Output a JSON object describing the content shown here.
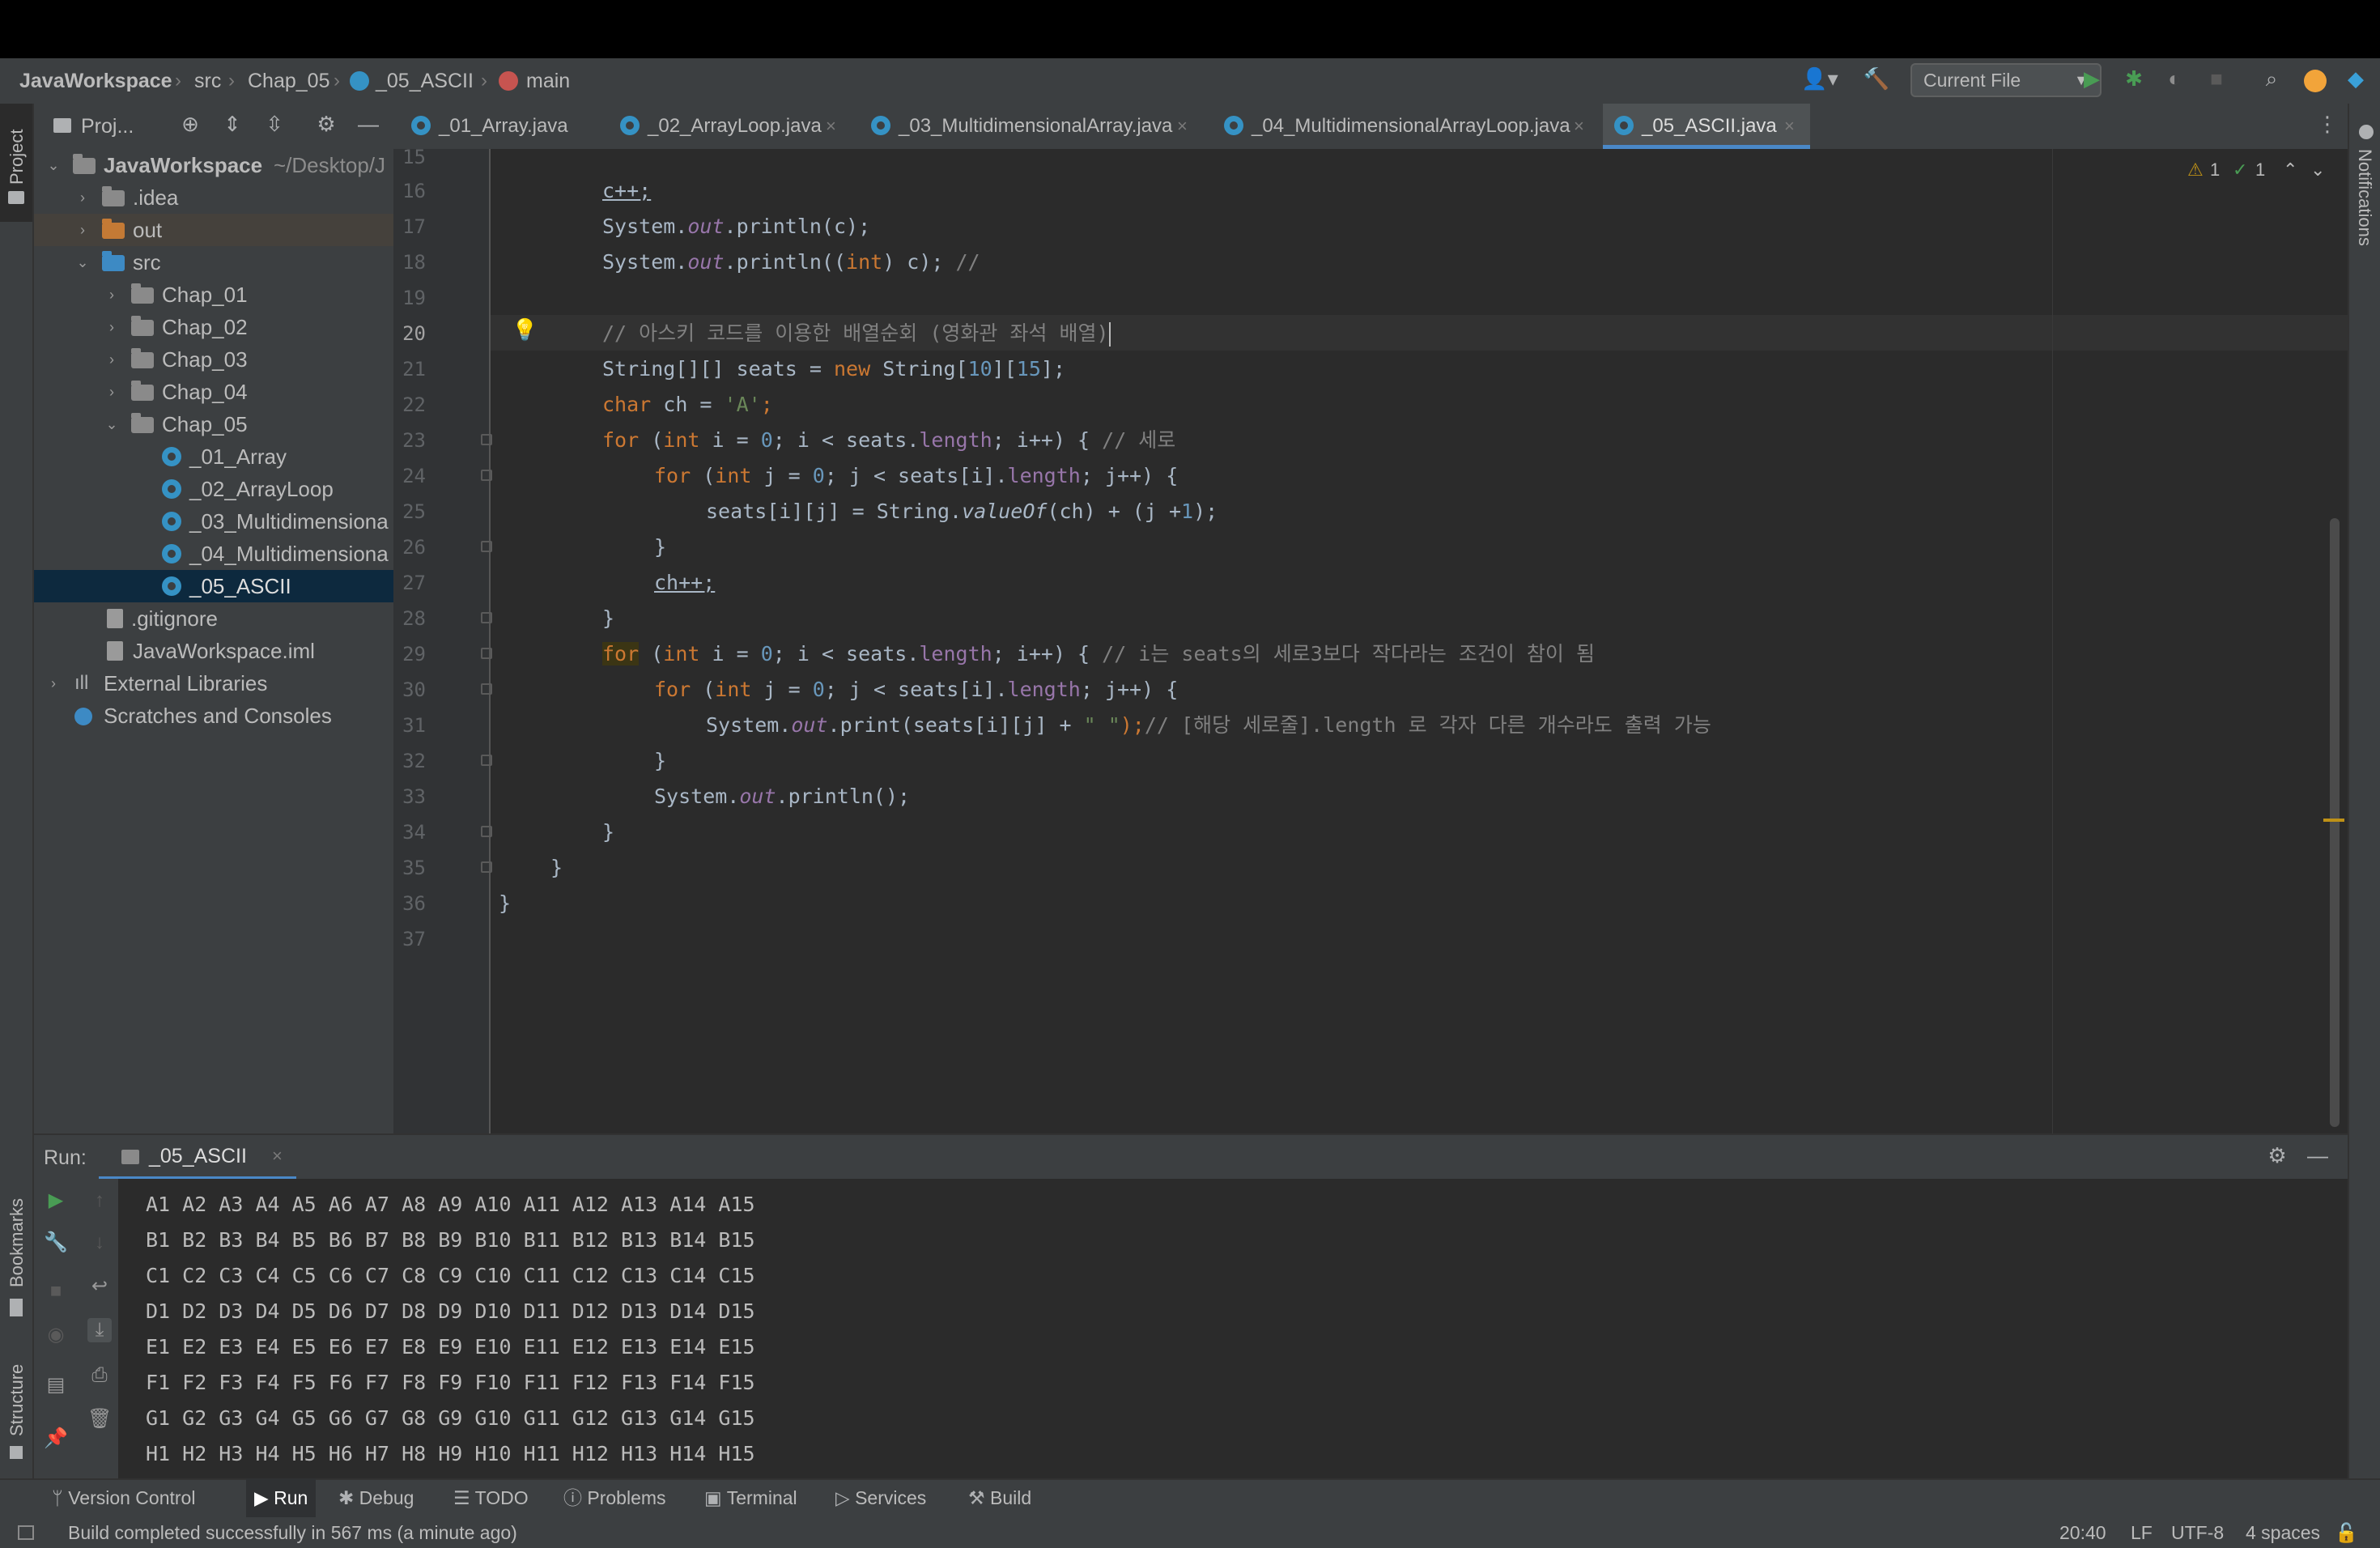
{
  "breadcrumb": {
    "project": "JavaWorkspace",
    "src": "src",
    "chapter": "Chap_05",
    "class": "_05_ASCII",
    "method": "main"
  },
  "toolbar": {
    "run_config": "Current File"
  },
  "stripes": {
    "project": "Project",
    "notifications": "Notifications",
    "bookmarks": "Bookmarks",
    "structure": "Structure"
  },
  "project_panel": {
    "title": "Proj...",
    "items": [
      {
        "label": "JavaWorkspace",
        "hint": "~/Desktop/J"
      },
      {
        "label": ".idea"
      },
      {
        "label": "out"
      },
      {
        "label": "src"
      },
      {
        "label": "Chap_01"
      },
      {
        "label": "Chap_02"
      },
      {
        "label": "Chap_03"
      },
      {
        "label": "Chap_04"
      },
      {
        "label": "Chap_05"
      },
      {
        "label": "_01_Array"
      },
      {
        "label": "_02_ArrayLoop"
      },
      {
        "label": "_03_Multidimensiona"
      },
      {
        "label": "_04_Multidimensiona"
      },
      {
        "label": "_05_ASCII"
      },
      {
        "label": ".gitignore"
      },
      {
        "label": "JavaWorkspace.iml"
      },
      {
        "label": "External Libraries"
      },
      {
        "label": "Scratches and Consoles"
      }
    ]
  },
  "tabs": [
    {
      "label": "_01_Array.java"
    },
    {
      "label": "_02_ArrayLoop.java"
    },
    {
      "label": "_03_MultidimensionalArray.java"
    },
    {
      "label": "_04_MultidimensionalArrayLoop.java"
    },
    {
      "label": "_05_ASCII.java"
    }
  ],
  "inspections": {
    "warnings": "1",
    "weak_warnings": "1"
  },
  "editor": {
    "line_numbers": [
      "15",
      "16",
      "17",
      "18",
      "19",
      "20",
      "21",
      "22",
      "23",
      "24",
      "25",
      "26",
      "27",
      "28",
      "29",
      "30",
      "31",
      "32",
      "33",
      "34",
      "35",
      "36",
      "37"
    ],
    "lines": {
      "l16": "c++;",
      "l17a": "System.",
      "l17b": "out",
      "l17c": ".println(c);",
      "l18a": "System.",
      "l18b": "out",
      "l18c": ".println((",
      "l18d": "int",
      "l18e": ") c); ",
      "l18f": "//",
      "l20": "// 아스키 코드를 이용한 배열순회 (영화관 좌석 배열)",
      "l21a": "String[][] seats = ",
      "l21b": "new",
      "l21c": " String[",
      "l21d": "10",
      "l21e": "][",
      "l21f": "15",
      "l21g": "];",
      "l22a": "char",
      "l22b": " ch = ",
      "l22c": "'A'",
      "l22d": ";",
      "l23a": "for",
      "l23b": " (",
      "l23c": "int",
      "l23d": " i = ",
      "l23e": "0",
      "l23f": "; i < seats.",
      "l23g": "length",
      "l23h": "; i++) { ",
      "l23i": "// 세로",
      "l24a": "for",
      "l24b": " (",
      "l24c": "int",
      "l24d": " j = ",
      "l24e": "0",
      "l24f": "; j < seats[i].",
      "l24g": "length",
      "l24h": "; j++) {",
      "l25a": "seats[i][j] = String.",
      "l25b": "valueOf",
      "l25c": "(ch) + (j +",
      "l25d": "1",
      "l25e": ");",
      "l26": "}",
      "l27": "ch++;",
      "l28": "}",
      "l29a": "for",
      "l29b": " (",
      "l29c": "int",
      "l29d": " i = ",
      "l29e": "0",
      "l29f": "; i < seats.",
      "l29g": "length",
      "l29h": "; i++) { ",
      "l29i": "// i는 seats의 세로3보다 작다라는 조건이 참이 됨",
      "l30a": "for",
      "l30b": " (",
      "l30c": "int",
      "l30d": " j = ",
      "l30e": "0",
      "l30f": "; j < seats[i].",
      "l30g": "length",
      "l30h": "; j++) {",
      "l31a": "System.",
      "l31b": "out",
      "l31c": ".print(seats[i][j] + ",
      "l31d": "\" \"",
      "l31e": ");",
      "l31f": "// [해당 세로줄].length 로 각자 다른 개수라도 출력 가능",
      "l32": "}",
      "l33a": "System.",
      "l33b": "out",
      "l33c": ".println();",
      "l34": "}",
      "l35": "}",
      "l36": "}"
    }
  },
  "run_panel": {
    "label": "Run:",
    "tab": "_05_ASCII",
    "output": [
      "A1 A2 A3 A4 A5 A6 A7 A8 A9 A10 A11 A12 A13 A14 A15",
      "B1 B2 B3 B4 B5 B6 B7 B8 B9 B10 B11 B12 B13 B14 B15",
      "C1 C2 C3 C4 C5 C6 C7 C8 C9 C10 C11 C12 C13 C14 C15",
      "D1 D2 D3 D4 D5 D6 D7 D8 D9 D10 D11 D12 D13 D14 D15",
      "E1 E2 E3 E4 E5 E6 E7 E8 E9 E10 E11 E12 E13 E14 E15",
      "F1 F2 F3 F4 F5 F6 F7 F8 F9 F10 F11 F12 F13 F14 F15",
      "G1 G2 G3 G4 G5 G6 G7 G8 G9 G10 G11 G12 G13 G14 G15",
      "H1 H2 H3 H4 H5 H6 H7 H8 H9 H10 H11 H12 H13 H14 H15"
    ]
  },
  "tool_windows": {
    "version_control": "Version Control",
    "run": "Run",
    "debug": "Debug",
    "todo": "TODO",
    "problems": "Problems",
    "terminal": "Terminal",
    "services": "Services",
    "build": "Build"
  },
  "status": {
    "message": "Build completed successfully in 567 ms (a minute ago)",
    "position": "20:40",
    "line_sep": "LF",
    "encoding": "UTF-8",
    "indent": "4 spaces"
  },
  "colors": {
    "accent": "#4a88c7",
    "keyword": "#cc7832",
    "number": "#6897bb",
    "string": "#6a8759",
    "comment": "#808080",
    "field": "#9876aa",
    "run_green": "#499c54",
    "warning": "#be9117"
  }
}
